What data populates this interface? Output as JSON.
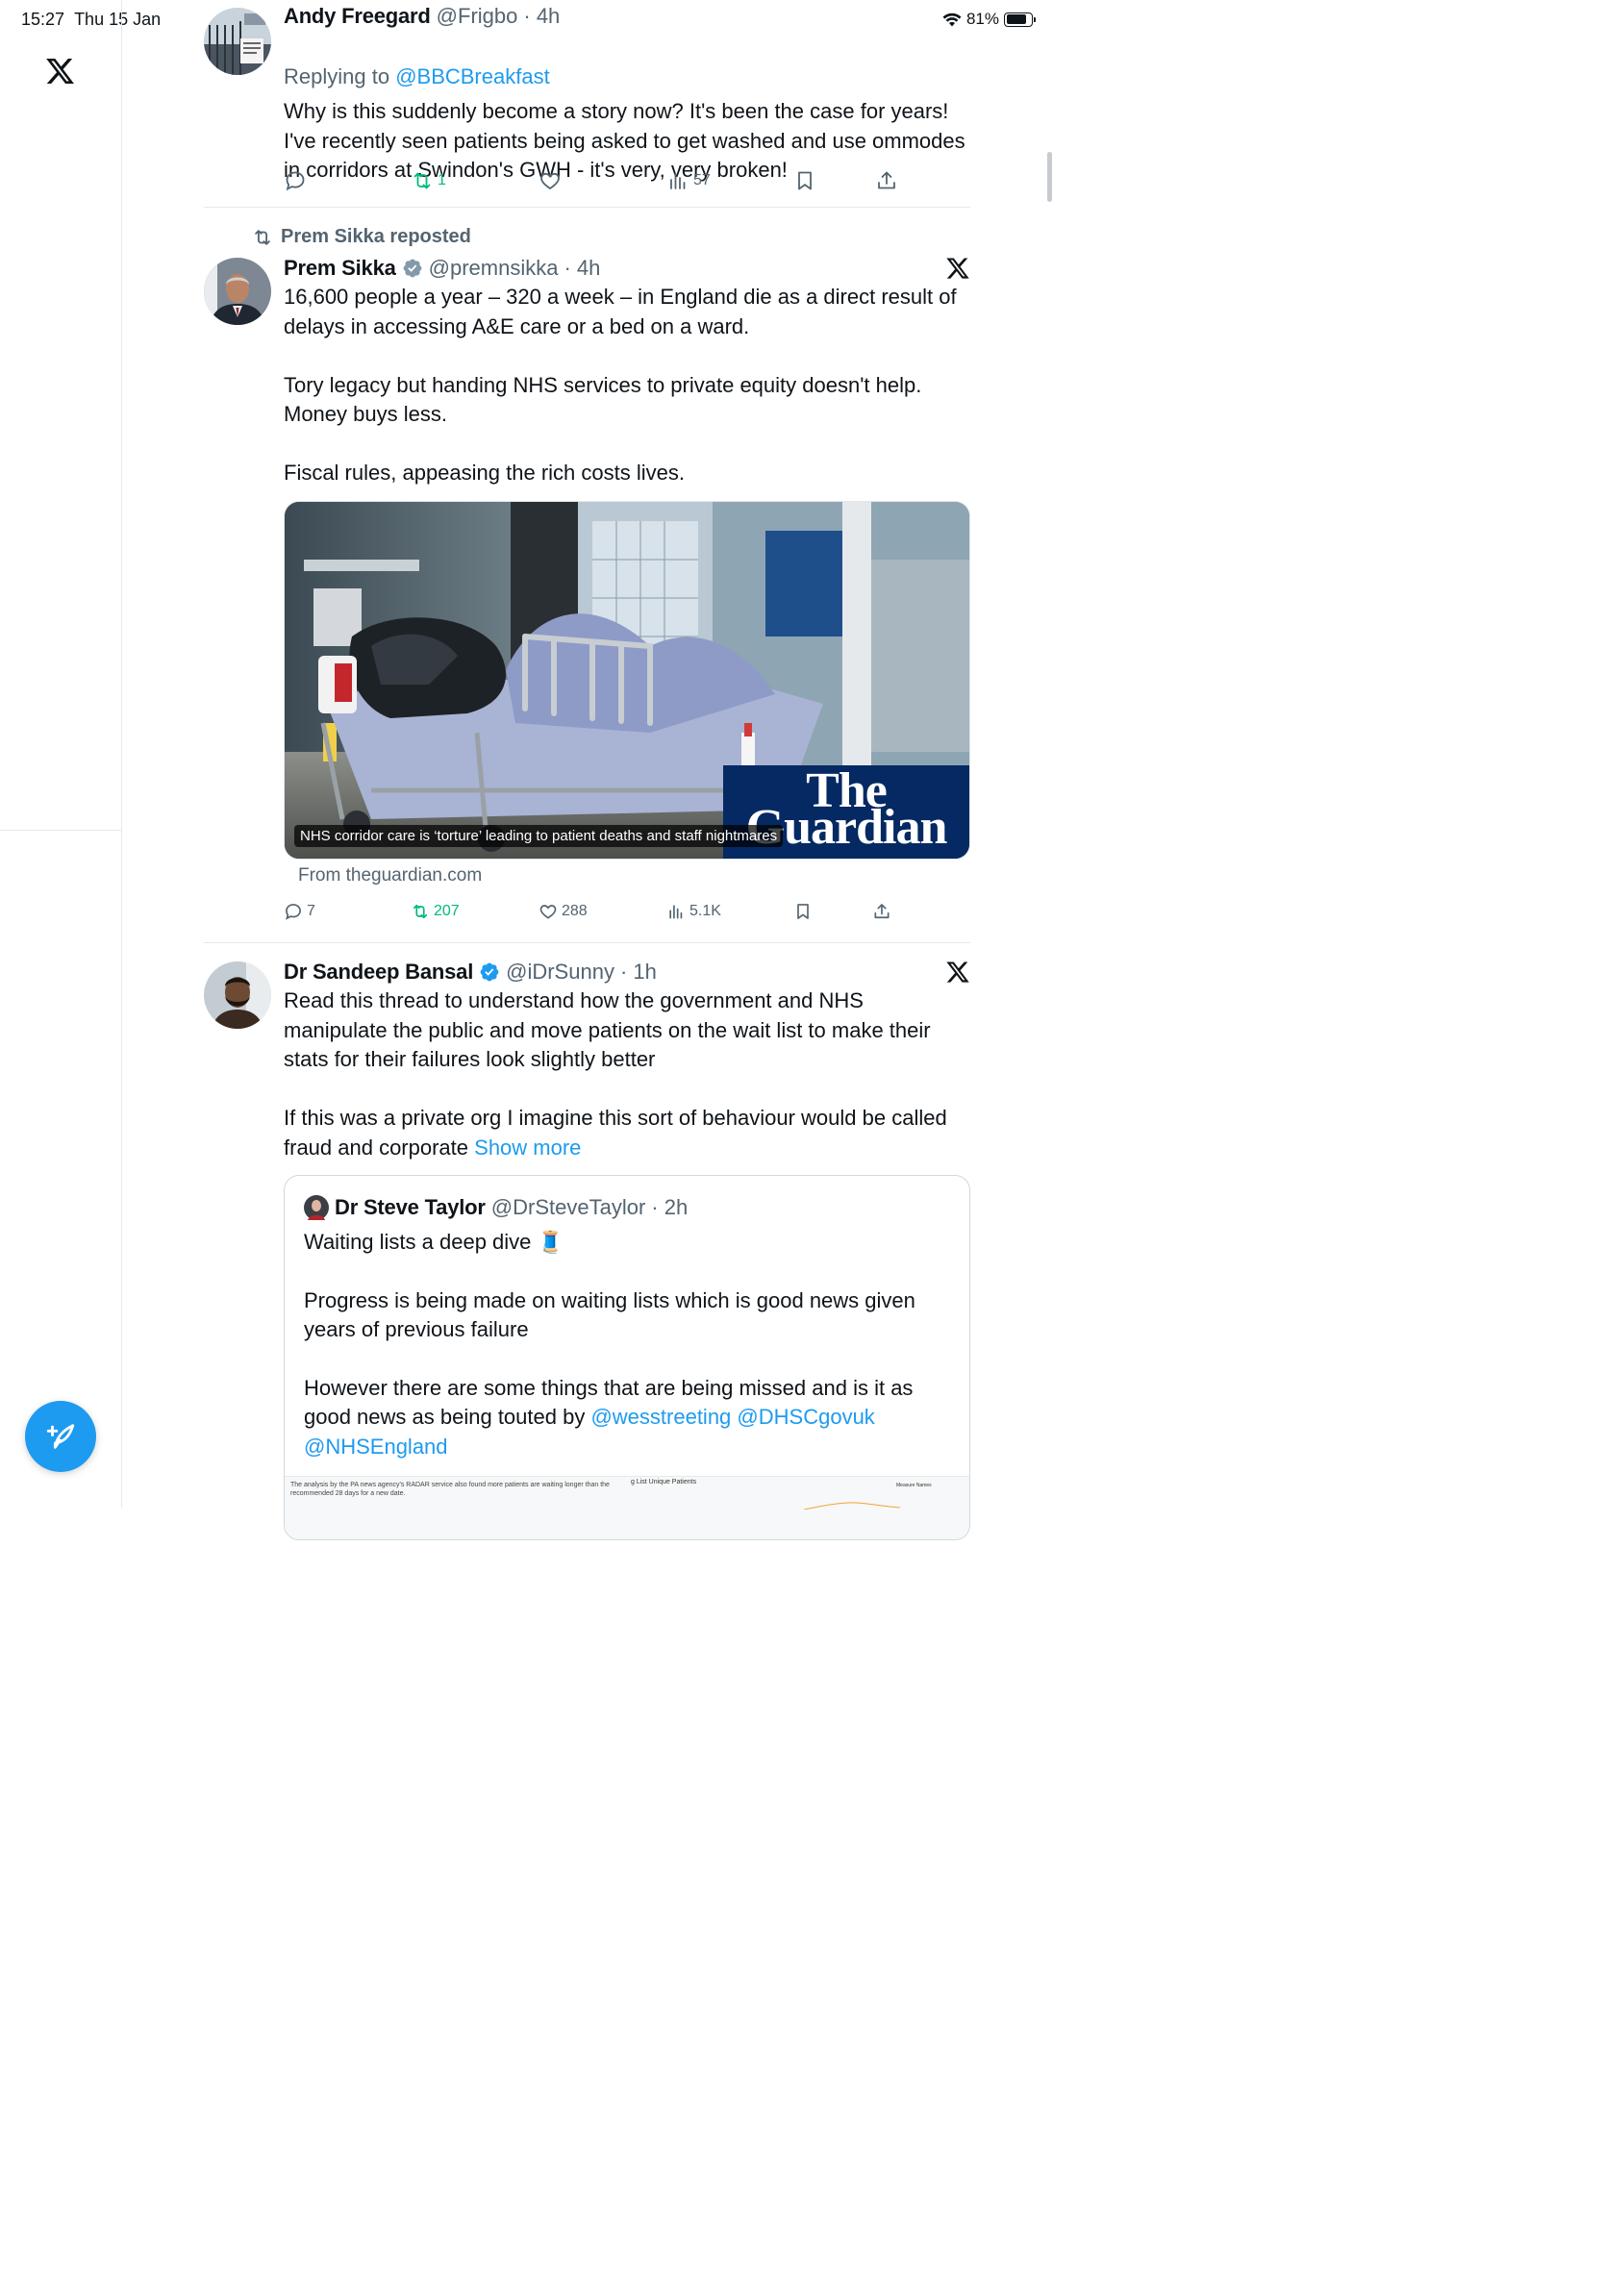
{
  "status_bar": {
    "time": "15:27",
    "date": "Thu 15 Jan",
    "battery": "81%",
    "battery_level": 0.81
  },
  "nav": {
    "logo": "x-logo-icon",
    "compose": "compose-icon"
  },
  "tweets": [
    {
      "name": "Andy Freegard",
      "handle": "@Frigbo",
      "time": "· 4h",
      "replying_prefix": "Replying to ",
      "replying_to": "@BBCBreakfast",
      "text": "Why is this suddenly become a story now? It's been the case for years! I've recently seen patients being asked to get washed and use ommodes in corridors at Swindon's GWH - it's very, very broken!",
      "reposts": "1",
      "views": "57"
    },
    {
      "repost_label": "Prem Sikka reposted",
      "name": "Prem Sikka",
      "handle": "@premnsikka",
      "time": "· 4h",
      "text": "16,600 people a year – 320 a week – in England die as a direct result of delays in accessing A&E care or a bed on a ward.\n\nTory legacy but handing NHS services to private equity doesn't help. Money buys less.\n\nFiscal rules, appeasing the rich costs lives.",
      "card_caption": "NHS corridor care is ‘torture’ leading to patient deaths and staff nightmares",
      "card_brand_line1": "The",
      "card_brand_line2": "Guardian",
      "card_source": "From theguardian.com",
      "replies": "7",
      "reposts": "207",
      "likes": "288",
      "views": "5.1K"
    },
    {
      "name": "Dr Sandeep Bansal",
      "handle": "@iDrSunny",
      "time": "· 1h",
      "text": "Read this thread to understand how the government and NHS manipulate the public and move patients on the wait list to make their stats for their failures look slightly better\n\nIf this was a private org I imagine this sort of behaviour would be called fraud and corporate ",
      "show_more": "Show more",
      "quote": {
        "name": "Dr Steve Taylor",
        "handle": "@DrSteveTaylor",
        "time": "· 2h",
        "text_line1": "Waiting lists a deep dive 🧵",
        "text_para2": "Progress is being made on waiting lists which is good news given years of previous failure",
        "text_para3": "However there are some things that are being missed and is it as good news as being touted by ",
        "mention1": "@wesstreeting",
        "mention2": "@DHSCgovuk",
        "mention3": "@NHSEngland",
        "preview_text": "The analysis by the PA news agency's RADAR service also found more patients are waiting longer than the recommended 28 days for a new date.",
        "preview_chart_title": "g List Unique Patients",
        "preview_legend": "Measure Names"
      }
    }
  ]
}
